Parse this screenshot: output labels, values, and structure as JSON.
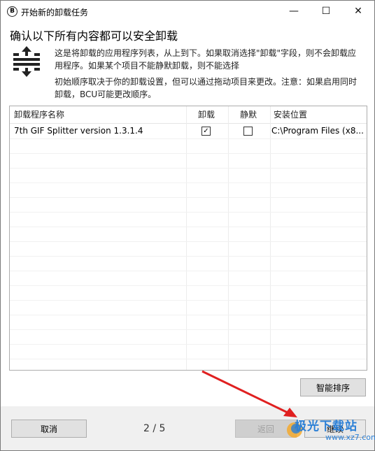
{
  "window": {
    "title": "开始新的卸载任务",
    "app_icon_letter": "B",
    "controls": {
      "minimize": "—",
      "maximize": "☐",
      "close": "✕"
    }
  },
  "heading": "确认以下所有内容都可以安全卸载",
  "description": {
    "line1": "这是将卸载的应用程序列表，从上到下。如果取消选择\"卸载\"字段，则不会卸载应",
    "line2": "用程序。如果某个项目不能静默卸载，则不能选择",
    "line3": "初始顺序取决于你的卸载设置，但可以通过拖动项目来更改。注意：如果启用同时",
    "line4": "卸载，BCU可能更改顺序。"
  },
  "table": {
    "columns": [
      "卸载程序名称",
      "卸载",
      "静默",
      "安装位置"
    ],
    "rows": [
      {
        "name": "7th GIF Splitter version 1.3.1.4",
        "uninstall": true,
        "quiet": false,
        "location": "C:\\Program Files (x8..."
      }
    ]
  },
  "buttons": {
    "smart_sort": "智能排序",
    "cancel": "取消",
    "back": "返回",
    "continue": "继续"
  },
  "pager": "2 / 5",
  "watermark": {
    "text": "极光下载站",
    "sub": "www.xz7.com"
  },
  "colors": {
    "arrow": "#e02020",
    "watermark": "#2a7fd6"
  }
}
